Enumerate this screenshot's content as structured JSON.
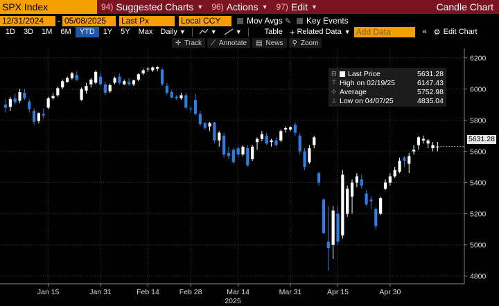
{
  "header": {
    "ticker": "SPX Index",
    "menus": [
      {
        "num": "94)",
        "label": "Suggested Charts"
      },
      {
        "num": "96)",
        "label": "Actions"
      },
      {
        "num": "97)",
        "label": "Edit"
      }
    ],
    "title": "Candle Chart"
  },
  "settings": {
    "start_date": "12/31/2024",
    "end_date": "05/08/2025",
    "field": "Last Px",
    "currency": "Local CCY",
    "mov_avgs": "Mov Avgs",
    "key_events": "Key Events"
  },
  "toolbar": {
    "periods": [
      "1D",
      "3D",
      "1M",
      "6M",
      "YTD",
      "1Y",
      "5Y",
      "Max"
    ],
    "selected_period": "YTD",
    "frequency": "Daily",
    "table": "Table",
    "related": "Related Data",
    "add_data_placeholder": "Add Data",
    "edit_chart": "Edit Chart"
  },
  "tools": [
    "Track",
    "Annotate",
    "News",
    "Zoom"
  ],
  "legend": {
    "last_price_label": "Last Price",
    "last_price": "5631.28",
    "high_label": "High on 02/19/25",
    "high": "6147.43",
    "avg_label": "Average",
    "avg": "5752.98",
    "low_label": "Low on 04/07/25",
    "low": "4835.04"
  },
  "current_price_label": "5631.28",
  "chart_data": {
    "type": "candlestick",
    "ylim": [
      4750,
      6260
    ],
    "yticks": [
      4800,
      5000,
      5200,
      5400,
      5600,
      5800,
      6000,
      6200
    ],
    "xticks": [
      {
        "label": "Jan 15",
        "index": 9
      },
      {
        "label": "Jan 31",
        "index": 20
      },
      {
        "label": "Feb 14",
        "index": 30
      },
      {
        "label": "Feb 28",
        "index": 39
      },
      {
        "label": "Mar 14",
        "index": 49
      },
      {
        "label": "Mar 31",
        "index": 60
      },
      {
        "label": "Apr 15",
        "index": 70
      },
      {
        "label": "Apr 30",
        "index": 81
      }
    ],
    "xlabel": "2025",
    "colors": {
      "up": "#ffffff",
      "down": "#2f7de1"
    },
    "candles": [
      {
        "o": 5900,
        "h": 5935,
        "l": 5850,
        "c": 5880
      },
      {
        "o": 5885,
        "h": 5950,
        "l": 5860,
        "c": 5935
      },
      {
        "o": 5940,
        "h": 5970,
        "l": 5900,
        "c": 5915
      },
      {
        "o": 5925,
        "h": 6000,
        "l": 5910,
        "c": 5980
      },
      {
        "o": 5975,
        "h": 6000,
        "l": 5930,
        "c": 5940
      },
      {
        "o": 5920,
        "h": 5935,
        "l": 5850,
        "c": 5870
      },
      {
        "o": 5860,
        "h": 5875,
        "l": 5770,
        "c": 5790
      },
      {
        "o": 5795,
        "h": 5850,
        "l": 5780,
        "c": 5845
      },
      {
        "o": 5840,
        "h": 5875,
        "l": 5810,
        "c": 5830
      },
      {
        "o": 5880,
        "h": 5950,
        "l": 5870,
        "c": 5940
      },
      {
        "o": 5940,
        "h": 5975,
        "l": 5930,
        "c": 5955
      },
      {
        "o": 5960,
        "h": 6015,
        "l": 5950,
        "c": 6005
      },
      {
        "o": 6010,
        "h": 6060,
        "l": 6000,
        "c": 6050
      },
      {
        "o": 6045,
        "h": 6080,
        "l": 6040,
        "c": 6070
      },
      {
        "o": 6070,
        "h": 6110,
        "l": 6060,
        "c": 6100
      },
      {
        "o": 6090,
        "h": 6115,
        "l": 6050,
        "c": 6060
      },
      {
        "o": 5930,
        "h": 6010,
        "l": 5925,
        "c": 6000
      },
      {
        "o": 5990,
        "h": 6040,
        "l": 5970,
        "c": 6020
      },
      {
        "o": 6030,
        "h": 6070,
        "l": 6010,
        "c": 6060
      },
      {
        "o": 6040,
        "h": 6120,
        "l": 6030,
        "c": 6110
      },
      {
        "o": 6080,
        "h": 6105,
        "l": 6020,
        "c": 6030
      },
      {
        "o": 6030,
        "h": 6050,
        "l": 5960,
        "c": 5975
      },
      {
        "o": 5985,
        "h": 6035,
        "l": 5975,
        "c": 6025
      },
      {
        "o": 6040,
        "h": 6080,
        "l": 6030,
        "c": 6070
      },
      {
        "o": 6080,
        "h": 6100,
        "l": 6030,
        "c": 6040
      },
      {
        "o": 6030,
        "h": 6060,
        "l": 6025,
        "c": 6050
      },
      {
        "o": 6045,
        "h": 6070,
        "l": 6020,
        "c": 6030
      },
      {
        "o": 6030,
        "h": 6060,
        "l": 6020,
        "c": 6055
      },
      {
        "o": 6060,
        "h": 6100,
        "l": 6050,
        "c": 6095
      },
      {
        "o": 6100,
        "h": 6130,
        "l": 6090,
        "c": 6120
      },
      {
        "o": 6125,
        "h": 6140,
        "l": 6110,
        "c": 6130
      },
      {
        "o": 6120,
        "h": 6145,
        "l": 6110,
        "c": 6138
      },
      {
        "o": 6130,
        "h": 6147,
        "l": 6115,
        "c": 6140
      },
      {
        "o": 6125,
        "h": 6135,
        "l": 6020,
        "c": 6030
      },
      {
        "o": 6020,
        "h": 6040,
        "l": 5960,
        "c": 5975
      },
      {
        "o": 5980,
        "h": 5995,
        "l": 5940,
        "c": 5945
      },
      {
        "o": 5950,
        "h": 5960,
        "l": 5930,
        "c": 5940
      },
      {
        "o": 5940,
        "h": 5975,
        "l": 5930,
        "c": 5960
      },
      {
        "o": 5960,
        "h": 5975,
        "l": 5870,
        "c": 5880
      },
      {
        "o": 5875,
        "h": 5890,
        "l": 5850,
        "c": 5870
      },
      {
        "o": 5930,
        "h": 5970,
        "l": 5830,
        "c": 5840
      },
      {
        "o": 5840,
        "h": 5860,
        "l": 5760,
        "c": 5775
      },
      {
        "o": 5780,
        "h": 5790,
        "l": 5740,
        "c": 5750
      },
      {
        "o": 5760,
        "h": 5790,
        "l": 5730,
        "c": 5780
      },
      {
        "o": 5785,
        "h": 5790,
        "l": 5650,
        "c": 5670
      },
      {
        "o": 5670,
        "h": 5730,
        "l": 5630,
        "c": 5720
      },
      {
        "o": 5700,
        "h": 5720,
        "l": 5560,
        "c": 5580
      },
      {
        "o": 5590,
        "h": 5630,
        "l": 5550,
        "c": 5570
      },
      {
        "o": 5610,
        "h": 5620,
        "l": 5520,
        "c": 5530
      },
      {
        "o": 5620,
        "h": 5630,
        "l": 5560,
        "c": 5580
      },
      {
        "o": 5580,
        "h": 5640,
        "l": 5570,
        "c": 5630
      },
      {
        "o": 5620,
        "h": 5640,
        "l": 5500,
        "c": 5510
      },
      {
        "o": 5550,
        "h": 5640,
        "l": 5540,
        "c": 5630
      },
      {
        "o": 5660,
        "h": 5690,
        "l": 5610,
        "c": 5680
      },
      {
        "o": 5680,
        "h": 5730,
        "l": 5665,
        "c": 5710
      },
      {
        "o": 5700,
        "h": 5720,
        "l": 5640,
        "c": 5650
      },
      {
        "o": 5660,
        "h": 5680,
        "l": 5630,
        "c": 5670
      },
      {
        "o": 5670,
        "h": 5690,
        "l": 5630,
        "c": 5640
      },
      {
        "o": 5670,
        "h": 5740,
        "l": 5660,
        "c": 5730
      },
      {
        "o": 5740,
        "h": 5760,
        "l": 5720,
        "c": 5750
      },
      {
        "o": 5740,
        "h": 5760,
        "l": 5730,
        "c": 5755
      },
      {
        "o": 5770,
        "h": 5785,
        "l": 5700,
        "c": 5720
      },
      {
        "o": 5700,
        "h": 5720,
        "l": 5580,
        "c": 5600
      },
      {
        "o": 5600,
        "h": 5620,
        "l": 5480,
        "c": 5500
      },
      {
        "o": 5530,
        "h": 5640,
        "l": 5520,
        "c": 5620
      },
      {
        "o": 5640,
        "h": 5700,
        "l": 5620,
        "c": 5690
      },
      {
        "o": 5460,
        "h": 5470,
        "l": 5380,
        "c": 5400
      },
      {
        "o": 5290,
        "h": 5300,
        "l": 5070,
        "c": 5075
      },
      {
        "o": 5020,
        "h": 5250,
        "l": 4835,
        "c": 4980
      },
      {
        "o": 5000,
        "h": 5250,
        "l": 4910,
        "c": 5220
      },
      {
        "o": 5200,
        "h": 5250,
        "l": 5000,
        "c": 5020
      },
      {
        "o": 5060,
        "h": 5480,
        "l": 5040,
        "c": 5450
      },
      {
        "o": 5200,
        "h": 5380,
        "l": 5180,
        "c": 5360
      },
      {
        "o": 5310,
        "h": 5420,
        "l": 5200,
        "c": 5400
      },
      {
        "o": 5400,
        "h": 5460,
        "l": 5370,
        "c": 5440
      },
      {
        "o": 5420,
        "h": 5450,
        "l": 5360,
        "c": 5380
      },
      {
        "o": 5330,
        "h": 5350,
        "l": 5250,
        "c": 5260
      },
      {
        "o": 5290,
        "h": 5310,
        "l": 5230,
        "c": 5280
      },
      {
        "o": 5230,
        "h": 5240,
        "l": 5100,
        "c": 5120
      },
      {
        "o": 5200,
        "h": 5310,
        "l": 5190,
        "c": 5300
      },
      {
        "o": 5360,
        "h": 5420,
        "l": 5350,
        "c": 5400
      },
      {
        "o": 5400,
        "h": 5460,
        "l": 5380,
        "c": 5440
      },
      {
        "o": 5440,
        "h": 5500,
        "l": 5430,
        "c": 5480
      },
      {
        "o": 5470,
        "h": 5560,
        "l": 5460,
        "c": 5540
      },
      {
        "o": 5560,
        "h": 5570,
        "l": 5500,
        "c": 5540
      },
      {
        "o": 5520,
        "h": 5590,
        "l": 5460,
        "c": 5570
      },
      {
        "o": 5600,
        "h": 5640,
        "l": 5580,
        "c": 5610
      },
      {
        "o": 5640,
        "h": 5700,
        "l": 5610,
        "c": 5690
      },
      {
        "o": 5670,
        "h": 5700,
        "l": 5650,
        "c": 5680
      },
      {
        "o": 5650,
        "h": 5680,
        "l": 5620,
        "c": 5670
      },
      {
        "o": 5620,
        "h": 5660,
        "l": 5600,
        "c": 5640
      },
      {
        "o": 5625,
        "h": 5660,
        "l": 5600,
        "c": 5631
      }
    ]
  }
}
